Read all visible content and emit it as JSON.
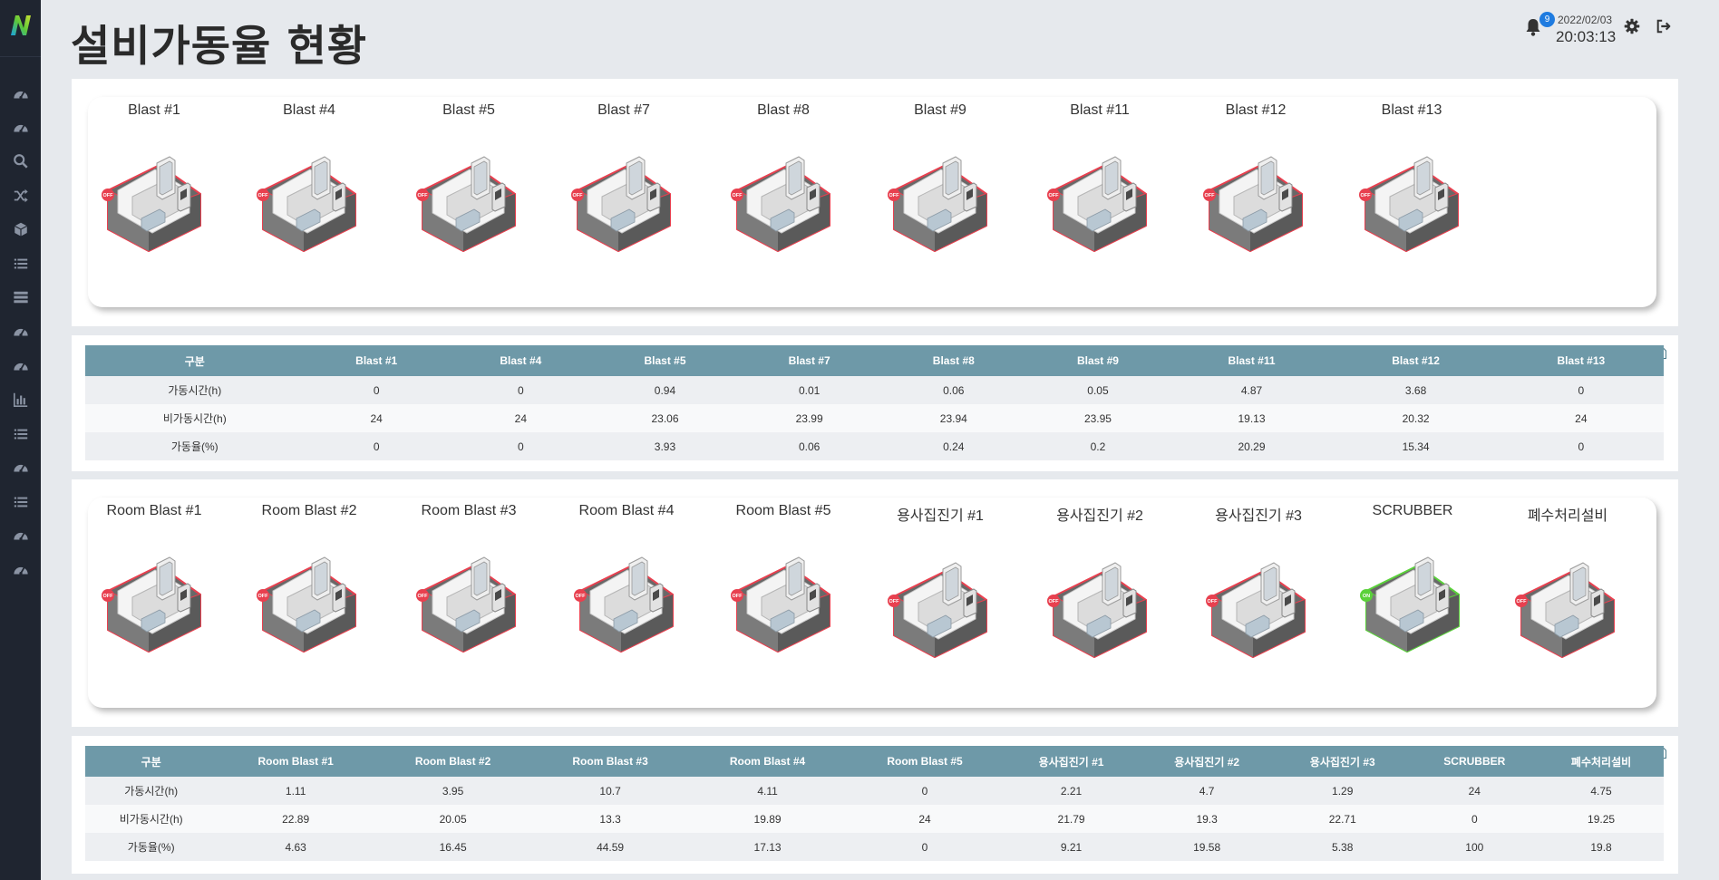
{
  "app": {
    "logo_letter": "N"
  },
  "sidebar": {
    "items": [
      {
        "icon": "dashboard-icon"
      },
      {
        "icon": "dashboard-icon"
      },
      {
        "icon": "search-icon"
      },
      {
        "icon": "shuffle-icon"
      },
      {
        "icon": "cube-icon"
      },
      {
        "icon": "list-icon"
      },
      {
        "icon": "server-icon"
      },
      {
        "icon": "dashboard-icon"
      },
      {
        "icon": "dashboard-icon"
      },
      {
        "icon": "bar-chart-icon"
      },
      {
        "icon": "list-icon"
      },
      {
        "icon": "dashboard-icon"
      },
      {
        "icon": "list-icon"
      },
      {
        "icon": "dashboard-icon"
      },
      {
        "icon": "dashboard-icon"
      }
    ]
  },
  "header": {
    "title": "설비가동율 현황",
    "notification_count": "9",
    "date": "2022/02/03",
    "time": "20:03:13"
  },
  "colors": {
    "off": "#e8404f",
    "on": "#5ad13a",
    "table_header": "#6e99a8",
    "sidebar": "#1f2530"
  },
  "section1": {
    "machines": [
      {
        "label": "Blast #1",
        "status": "OFF"
      },
      {
        "label": "Blast #4",
        "status": "OFF"
      },
      {
        "label": "Blast #5",
        "status": "OFF"
      },
      {
        "label": "Blast #7",
        "status": "OFF"
      },
      {
        "label": "Blast #8",
        "status": "OFF"
      },
      {
        "label": "Blast #9",
        "status": "OFF"
      },
      {
        "label": "Blast #11",
        "status": "OFF"
      },
      {
        "label": "Blast #12",
        "status": "OFF"
      },
      {
        "label": "Blast #13",
        "status": "OFF"
      }
    ],
    "table": {
      "headers": [
        "구분",
        "Blast #1",
        "Blast #4",
        "Blast #5",
        "Blast #7",
        "Blast #8",
        "Blast #9",
        "Blast #11",
        "Blast #12",
        "Blast #13"
      ],
      "rows": [
        [
          "가동시간(h)",
          "0",
          "0",
          "0.94",
          "0.01",
          "0.06",
          "0.05",
          "4.87",
          "3.68",
          "0"
        ],
        [
          "비가동시간(h)",
          "24",
          "24",
          "23.06",
          "23.99",
          "23.94",
          "23.95",
          "19.13",
          "20.32",
          "24"
        ],
        [
          "가동율(%)",
          "0",
          "0",
          "3.93",
          "0.06",
          "0.24",
          "0.2",
          "20.29",
          "15.34",
          "0"
        ]
      ]
    }
  },
  "section2": {
    "machines": [
      {
        "label": "Room Blast #1",
        "status": "OFF"
      },
      {
        "label": "Room Blast #2",
        "status": "OFF"
      },
      {
        "label": "Room Blast #3",
        "status": "OFF"
      },
      {
        "label": "Room Blast #4",
        "status": "OFF"
      },
      {
        "label": "Room Blast #5",
        "status": "OFF"
      },
      {
        "label": "용사집진기 #1",
        "status": "OFF"
      },
      {
        "label": "용사집진기 #2",
        "status": "OFF"
      },
      {
        "label": "용사집진기 #3",
        "status": "OFF"
      },
      {
        "label": "SCRUBBER",
        "status": "ON"
      },
      {
        "label": "폐수처리설비",
        "status": "OFF"
      }
    ],
    "table": {
      "headers": [
        "구분",
        "Room Blast #1",
        "Room Blast #2",
        "Room Blast #3",
        "Room Blast #4",
        "Room Blast #5",
        "용사집진기 #1",
        "용사집진기 #2",
        "용사집진기 #3",
        "SCRUBBER",
        "폐수처리설비"
      ],
      "rows": [
        [
          "가동시간(h)",
          "1.11",
          "3.95",
          "10.7",
          "4.11",
          "0",
          "2.21",
          "4.7",
          "1.29",
          "24",
          "4.75"
        ],
        [
          "비가동시간(h)",
          "22.89",
          "20.05",
          "13.3",
          "19.89",
          "24",
          "21.79",
          "19.3",
          "22.71",
          "0",
          "19.25"
        ],
        [
          "가동율(%)",
          "4.63",
          "16.45",
          "44.59",
          "17.13",
          "0",
          "9.21",
          "19.58",
          "5.38",
          "100",
          "19.8"
        ]
      ]
    }
  }
}
